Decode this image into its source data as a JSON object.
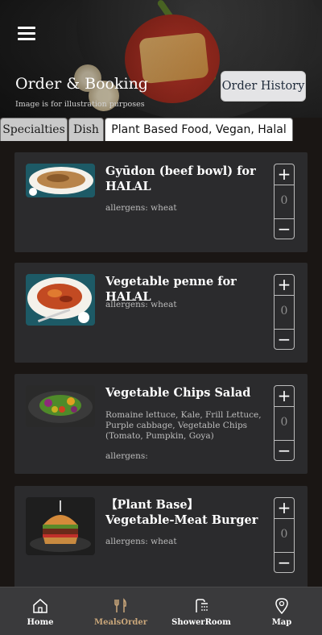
{
  "header": {
    "title": "Order & Booking",
    "subtitle": "Image is for illustration purposes",
    "order_history_label": "Order History",
    "menu_icon": "hamburger-menu-icon"
  },
  "tabs": [
    {
      "label": "Specialties",
      "active": false
    },
    {
      "label": "Dish",
      "active": false
    },
    {
      "label": "Plant Based Food, Vegan, Halal",
      "active": true
    }
  ],
  "menu_items": [
    {
      "name": "Gyūdon (beef bowl) for HALAL",
      "description": "",
      "allergens": "allergens: wheat",
      "quantity": "0",
      "plus": "+",
      "minus": "−"
    },
    {
      "name": "Vegetable penne for HALAL",
      "description": "",
      "allergens": "allergens: wheat",
      "quantity": "0",
      "plus": "+",
      "minus": "−"
    },
    {
      "name": "Vegetable Chips Salad",
      "description": "Romaine lettuce, Kale, Frill Lettuce, Purple cabbage, Vegetable Chips (Tomato, Pumpkin, Goya)",
      "allergens": "allergens:",
      "quantity": "0",
      "plus": "+",
      "minus": "−"
    },
    {
      "name": "【Plant Base】Vegetable-Meat Burger",
      "description": "",
      "allergens": "allergens: wheat",
      "quantity": "0",
      "plus": "+",
      "minus": "−"
    }
  ],
  "bottom_nav": [
    {
      "label": "Home",
      "icon": "home-icon",
      "active": false
    },
    {
      "label": "MealsOrder",
      "icon": "fork-knife-icon",
      "active": true
    },
    {
      "label": "ShowerRoom",
      "icon": "shower-icon",
      "active": false
    },
    {
      "label": "Map",
      "icon": "map-pin-icon",
      "active": false
    }
  ],
  "colors": {
    "background": "#1a1614",
    "card": "#2b2b2d",
    "active_nav": "#c9a67a",
    "nav_bar": "#3a3a3c"
  }
}
